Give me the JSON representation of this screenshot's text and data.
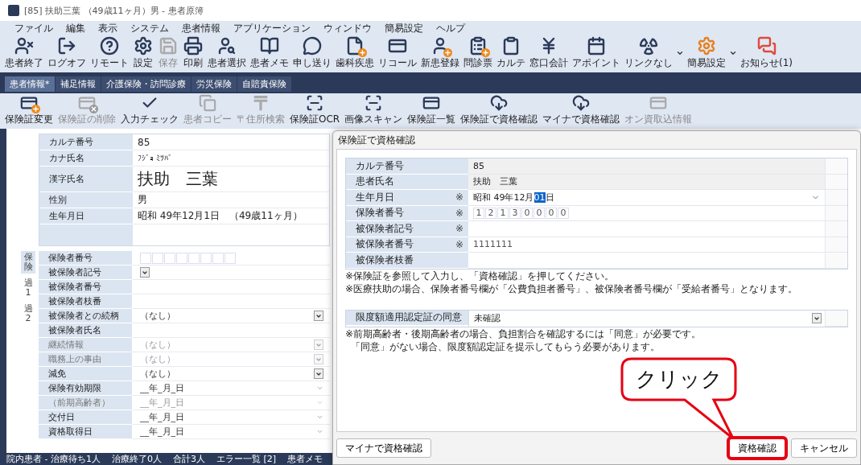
{
  "window": {
    "title": "[85] 扶助三葉 （49歳11ヶ月）男 - 患者原簿"
  },
  "menu": [
    "ファイル",
    "編集",
    "表示",
    "システム",
    "患者情報",
    "アプリケーション",
    "ウィンドウ",
    "簡易設定",
    "ヘルプ"
  ],
  "toolbar": [
    {
      "label": "患者終了",
      "disabled": false,
      "dropdown": false
    },
    {
      "label": "ログオフ",
      "disabled": false,
      "dropdown": false
    },
    {
      "label": "リモート",
      "disabled": false,
      "dropdown": false
    },
    {
      "label": "設定",
      "disabled": false,
      "dropdown": false
    },
    {
      "label": "保存",
      "disabled": true,
      "dropdown": false
    },
    {
      "label": "印刷",
      "disabled": false,
      "dropdown": false
    },
    {
      "label": "患者選択",
      "disabled": false,
      "dropdown": false
    },
    {
      "label": "患者メモ",
      "disabled": false,
      "dropdown": false
    },
    {
      "label": "申し送り",
      "disabled": false,
      "dropdown": false
    },
    {
      "label": "歯科疾患",
      "disabled": false,
      "dropdown": false
    },
    {
      "label": "リコール",
      "disabled": false,
      "dropdown": false
    },
    {
      "label": "新患登録",
      "disabled": false,
      "dropdown": false
    },
    {
      "label": "問診票",
      "disabled": false,
      "dropdown": false
    },
    {
      "label": "カルテ",
      "disabled": false,
      "dropdown": false
    },
    {
      "label": "窓口会計",
      "disabled": false,
      "dropdown": false
    },
    {
      "label": "アポイント",
      "disabled": false,
      "dropdown": false
    },
    {
      "label": "リンクなし",
      "disabled": false,
      "dropdown": true
    },
    {
      "label": "簡易設定",
      "disabled": false,
      "dropdown": true
    },
    {
      "label": "お知らせ(1)",
      "disabled": false,
      "dropdown": false
    }
  ],
  "tabs": [
    {
      "label": "患者情報*",
      "selected": true
    },
    {
      "label": "補足情報",
      "selected": false
    },
    {
      "label": "介護保険・訪問診療",
      "selected": false
    },
    {
      "label": "労災保険",
      "selected": false
    },
    {
      "label": "自賠責保険",
      "selected": false
    }
  ],
  "subtoolbar": [
    {
      "label": "保険証変更",
      "disabled": false
    },
    {
      "label": "保険証の削除",
      "disabled": true
    },
    {
      "label": "入力チェック",
      "disabled": false
    },
    {
      "label": "患者コピー",
      "disabled": true
    },
    {
      "label": "〒住所検索",
      "disabled": true
    },
    {
      "label": "保険証OCR",
      "disabled": false
    },
    {
      "label": "画像スキャン",
      "disabled": false
    },
    {
      "label": "保険証一覧",
      "disabled": false
    },
    {
      "label": "保険証で資格確認",
      "disabled": false
    },
    {
      "label": "マイナで資格確認",
      "disabled": false
    },
    {
      "label": "オン資取込情報",
      "disabled": true
    }
  ],
  "patient": [
    {
      "label": "カルテ番号",
      "value": "85",
      "kind": "text"
    },
    {
      "label": "カナ氏名",
      "value": "ﾌｼﾞｮ ﾐﾂﾊﾞ",
      "kind": "small"
    },
    {
      "label": "漢字氏名",
      "value": "扶助　三葉",
      "kind": "large"
    },
    {
      "label": "性別",
      "value": "男",
      "kind": "text"
    },
    {
      "label": "生年月日",
      "value": "昭和 49年12月1日　（49歳11ヶ月）",
      "kind": "text"
    }
  ],
  "insurance_panel": {
    "side_tabs": [
      {
        "label": "保険",
        "selected": true
      },
      {
        "label": "過1",
        "selected": false
      },
      {
        "label": "過2",
        "selected": false
      }
    ],
    "rows": [
      {
        "label": "保険者番号",
        "kind": "digits",
        "disabled": false
      },
      {
        "label": "被保険者記号",
        "kind": "select",
        "disabled": false
      },
      {
        "label": "被保険者番号",
        "kind": "text",
        "disabled": false
      },
      {
        "label": "被保険者枝番",
        "kind": "text",
        "disabled": false
      },
      {
        "label": "被保険者との続柄",
        "kind": "select",
        "value": "（なし）",
        "disabled": false
      },
      {
        "label": "被保険者氏名",
        "kind": "text",
        "disabled": false
      },
      {
        "label": "継続情報",
        "kind": "select",
        "value": "（なし）",
        "disabled": true
      },
      {
        "label": "職務上の事由",
        "kind": "select",
        "value": "（なし）",
        "disabled": true
      },
      {
        "label": "減免",
        "kind": "select",
        "value": "（なし）",
        "disabled": false
      },
      {
        "label": "保険有効期限",
        "kind": "date",
        "value": "__年_月_日",
        "disabled": false
      },
      {
        "label": "（前期高齢者）",
        "kind": "date",
        "value": "__年_月_日",
        "disabled": true
      },
      {
        "label": "交付日",
        "kind": "date",
        "value": "__年_月_日",
        "disabled": false
      },
      {
        "label": "資格取得日",
        "kind": "date",
        "value": "__年_月_日",
        "disabled": false
      }
    ]
  },
  "dialog": {
    "title": "保険証で資格確認",
    "rows": [
      {
        "label": "カルテ番号",
        "required": false,
        "kind": "readonly",
        "value": "85"
      },
      {
        "label": "患者氏名",
        "required": false,
        "kind": "readonly",
        "value": "扶助　三葉"
      },
      {
        "label": "生年月日",
        "required": true,
        "kind": "date",
        "value": "昭和 49年12月",
        "selection": "01",
        "after": "日"
      },
      {
        "label": "保険者番号",
        "required": true,
        "kind": "digits",
        "digits": [
          "1",
          "2",
          "1",
          "3",
          "0",
          "0",
          "0",
          "0"
        ]
      },
      {
        "label": "被保険者記号",
        "required": true,
        "kind": "input"
      },
      {
        "label": "被保険者番号",
        "required": true,
        "kind": "input",
        "value": "1111111"
      },
      {
        "label": "被保険者枝番",
        "required": false,
        "kind": "input"
      }
    ],
    "required_mark": "※",
    "notes1": [
      "※保険証を参照して入力し、「資格確認」を押してください。",
      "※医療扶助の場合、保険者番号欄が「公費負担者番号」、被保険者番号欄が「受給者番号」となります。"
    ],
    "consent": {
      "label": "限度額適用認定証の同意",
      "value": "未確認"
    },
    "notes2": [
      "※前期高齢者・後期高齢者の場合、負担割合を確認するには「同意」が必要です。",
      "「同意」がない場合、限度額認定証を提示してもらう必要があります。"
    ],
    "buttons": [
      {
        "label": "マイナで資格確認",
        "highlighted": false
      },
      {
        "label": "資格確認",
        "highlighted": true
      },
      {
        "label": "キャンセル",
        "highlighted": false
      }
    ]
  },
  "callout": {
    "text": "クリック"
  },
  "status_bar": [
    "院内患者 - 治療待ち1人",
    "治療終了0人",
    "合計3人",
    "エラー一覧 [2]",
    "患者メモ"
  ]
}
